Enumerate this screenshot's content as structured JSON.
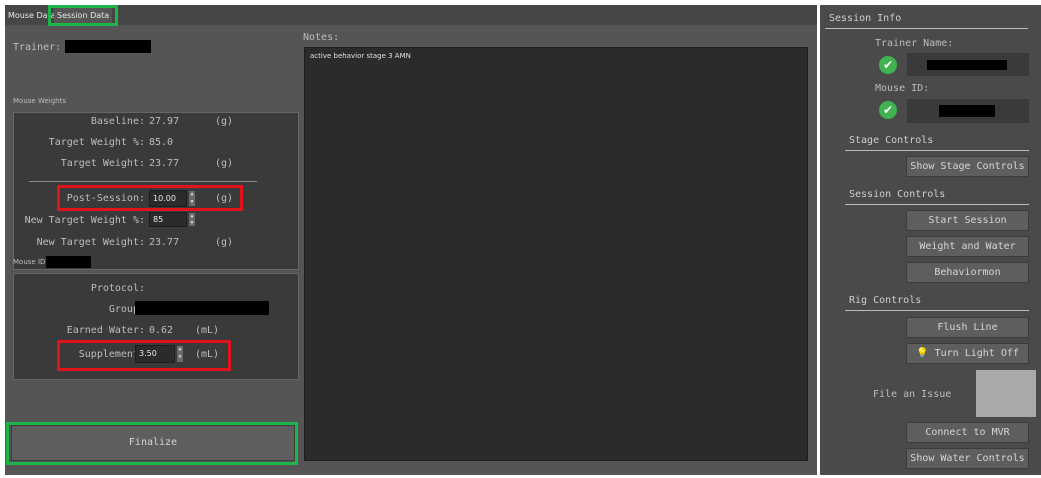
{
  "tabs": [
    {
      "label": "Mouse Data"
    },
    {
      "label": "Session Data"
    }
  ],
  "trainer": {
    "label": "Trainer:"
  },
  "weights": {
    "section_label": "Mouse Weights",
    "baseline_label": "Baseline:",
    "baseline_value": "27.97",
    "baseline_unit": "(g)",
    "target_pct_label": "Target Weight %:",
    "target_pct_value": "85.0",
    "target_weight_label": "Target Weight:",
    "target_weight_value": "23.77",
    "target_weight_unit": "(g)",
    "post_session_label": "Post-Session:",
    "post_session_value": "10.00",
    "post_session_unit": "(g)",
    "new_target_pct_label": "New Target Weight %:",
    "new_target_pct_value": "85",
    "new_target_weight_label": "New Target Weight:",
    "new_target_weight_value": "23.77",
    "new_target_weight_unit": "(g)"
  },
  "mouse_id": {
    "label": "Mouse ID:"
  },
  "protocol": {
    "protocol_label": "Protocol:",
    "group_label": "Group:",
    "earned_water_label": "Earned Water:",
    "earned_water_value": "0.62",
    "earned_water_unit": "(mL)",
    "supplement_label": "Supplement:",
    "supplement_value": "3.50",
    "supplement_unit": "(mL)"
  },
  "notes": {
    "label": "Notes:",
    "text": "active behavior stage 3 AMN"
  },
  "finalize": {
    "label": "Finalize"
  },
  "session_info": {
    "title": "Session Info",
    "trainer_name_label": "Trainer Name:",
    "mouse_id_label": "Mouse ID:"
  },
  "stage_controls": {
    "title": "Stage Controls",
    "show_button": "Show Stage Controls"
  },
  "session_controls": {
    "title": "Session Controls",
    "start_button": "Start Session",
    "weight_water_button": "Weight and Water",
    "behaviormon_button": "Behaviormon"
  },
  "rig_controls": {
    "title": "Rig Controls",
    "flush_button": "Flush Line",
    "light_button": "Turn Light Off"
  },
  "issue": {
    "label": "File an Issue"
  },
  "bottom": {
    "connect_button": "Connect to MVR",
    "water_controls_button": "Show Water Controls"
  },
  "colors": {
    "highlight_red": "#e0141c",
    "highlight_green": "#1db44a",
    "check_green": "#3fb34f"
  }
}
